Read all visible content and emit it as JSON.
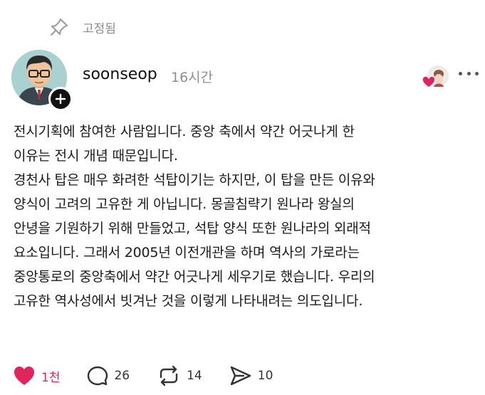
{
  "pinned": {
    "label": "고정됨",
    "icon": "pin-icon"
  },
  "author": {
    "username": "soonseop",
    "timestamp": "16시간"
  },
  "post": {
    "lines": [
      "전시기획에 참여한 사람입니다. 중앙 축에서 약간 어긋나게 한",
      "이유는 전시 개념 때문입니다.",
      "경천사 탑은 매우 화려한 석탑이기는 하지만, 이 탑을 만든 이유와",
      "양식이 고려의 고유한 게 아닙니다. 몽골침략기 원나라 왕실의",
      "안녕을 기원하기 위해 만들었고, 석탑 양식 또한 원나라의 외래적",
      "요소입니다. 그래서 2005년 이전개관을 하며 역사의 가로라는",
      "중앙통로의 중앙축에서 약간 어긋나게 세우기로 했습니다. 우리의",
      "고유한 역사성에서 빗겨난 것을 이렇게 나타내려는 의도입니다."
    ]
  },
  "actions": {
    "like": {
      "count": "1천",
      "icon": "heart-filled-icon",
      "color": "#e0245e"
    },
    "reply": {
      "count": "26",
      "icon": "comment-icon"
    },
    "repost": {
      "count": "14",
      "icon": "repost-icon"
    },
    "share": {
      "count": "10",
      "icon": "send-icon"
    }
  },
  "colors": {
    "accent": "#e0245e",
    "muted": "#8f8f8f",
    "text": "#1a1a1a"
  }
}
